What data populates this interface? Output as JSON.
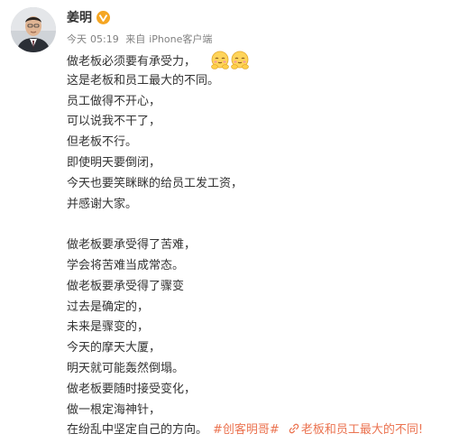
{
  "author": {
    "name": "姜明",
    "verified": true
  },
  "meta": {
    "day": "今天",
    "time": "05:19",
    "from_prefix": "来自",
    "source": "iPhone客户端"
  },
  "post": {
    "lines": [
      "做老板必须要有承受力，",
      "这是老板和员工最大的不同。",
      "员工做得不开心，",
      "可以说我不干了，",
      "但老板不行。",
      "即使明天要倒闭，",
      "今天也要笑眯眯的给员工发工资，",
      "并感谢大家。",
      "",
      "做老板要承受得了苦难，",
      "学会将苦难当成常态。",
      "做老板要承受得了骤变",
      "过去是确定的，",
      "未来是骤变的，",
      "今天的摩天大厦，",
      "明天就可能轰然倒塌。",
      "做老板要随时接受变化，",
      "做一根定海神针，",
      "在纷乱中坚定自己的方向。"
    ],
    "emoji": [
      "hug-emoji",
      "hug-emoji"
    ],
    "hashtag": "#创客明哥#",
    "topic_link": "老板和员工最大的不同!",
    "colors": {
      "link": "#eb7350",
      "text": "#333333",
      "meta": "#808080",
      "verified_badge": "#f5a623"
    }
  }
}
